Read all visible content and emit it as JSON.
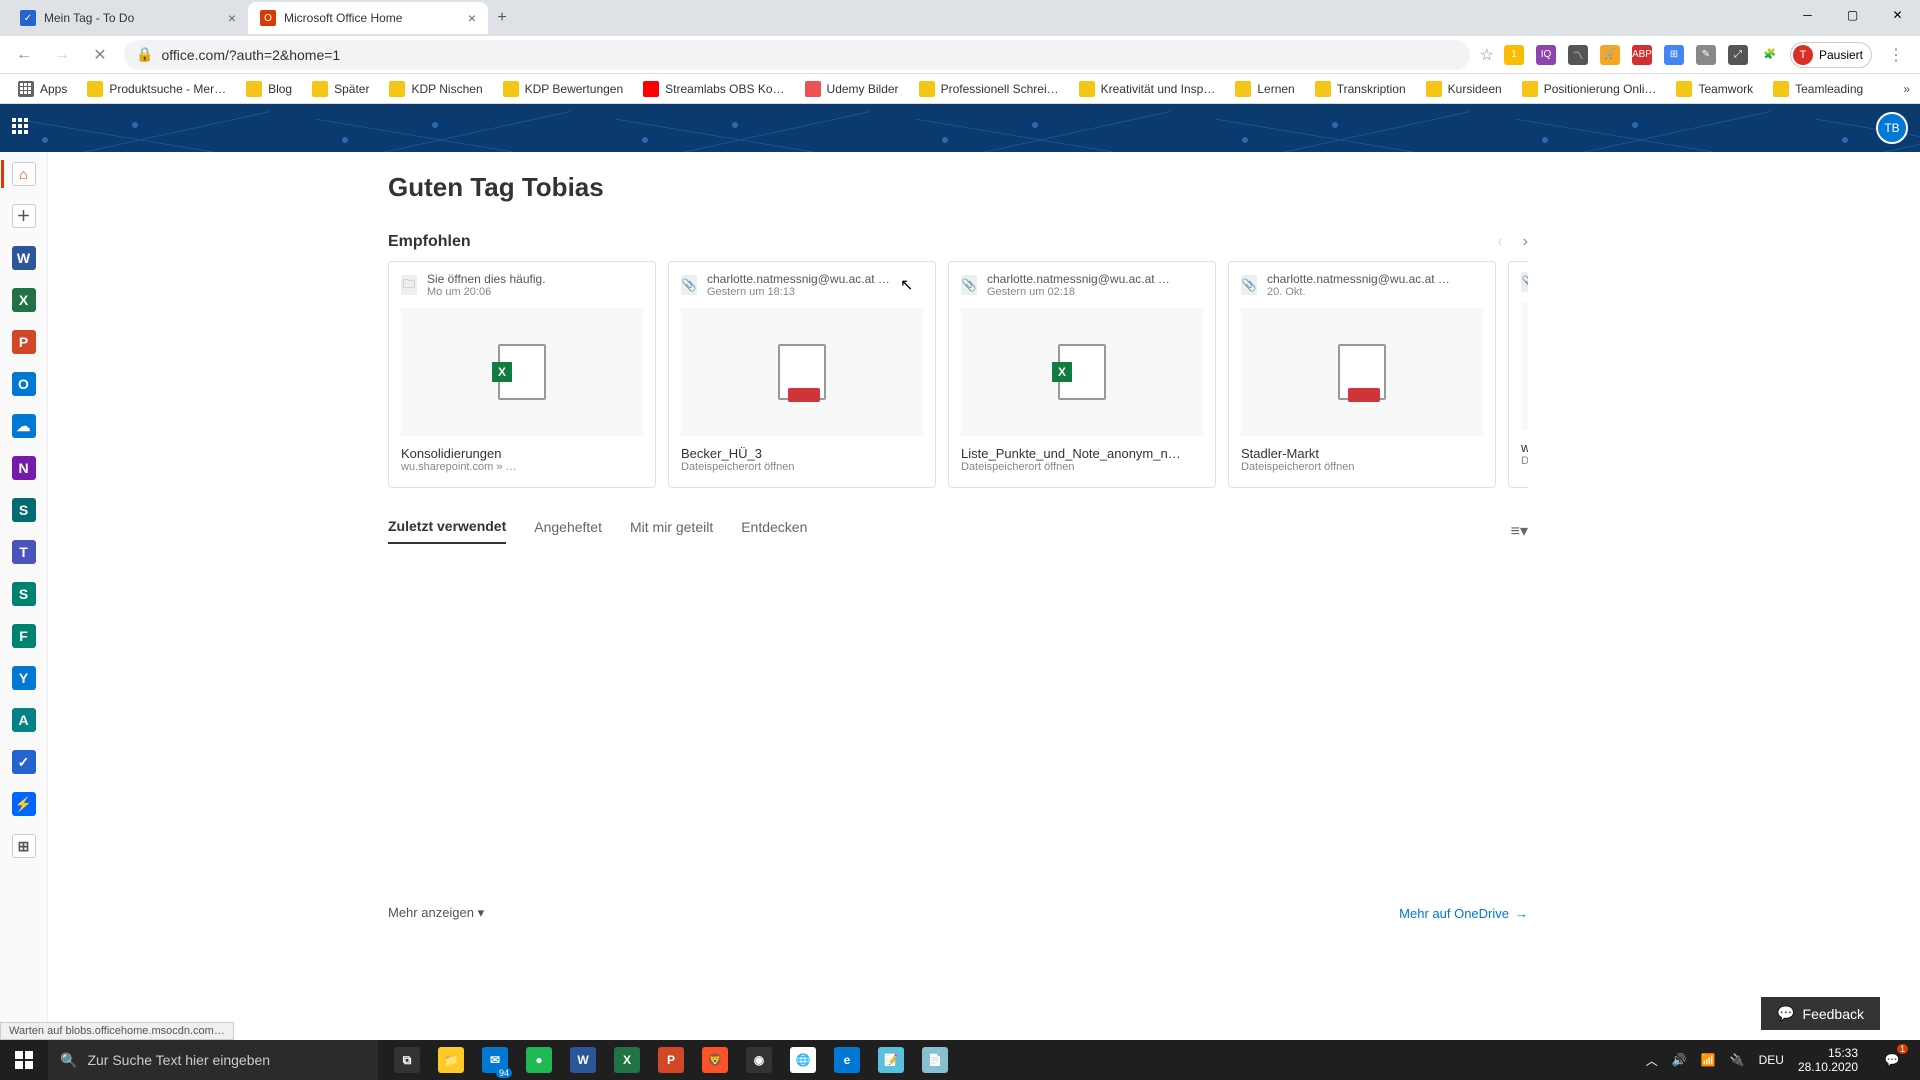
{
  "browser": {
    "tabs": [
      {
        "title": "Mein Tag - To Do",
        "active": false,
        "favicon_bg": "#2564cf"
      },
      {
        "title": "Microsoft Office Home",
        "active": true,
        "favicon_bg": "#d83b01"
      }
    ],
    "url": "office.com/?auth=2&home=1",
    "profile_label": "Pausiert",
    "profile_initial": "T",
    "bookmarks": [
      {
        "label": "Apps",
        "icon": "#5f6368"
      },
      {
        "label": "Produktsuche - Mer…",
        "icon": "#f5c518"
      },
      {
        "label": "Blog",
        "icon": "#f5c518"
      },
      {
        "label": "Später",
        "icon": "#f5c518"
      },
      {
        "label": "KDP Nischen",
        "icon": "#f5c518"
      },
      {
        "label": "KDP Bewertungen",
        "icon": "#f5c518"
      },
      {
        "label": "Streamlabs OBS Ko…",
        "icon": "#ff0000"
      },
      {
        "label": "Udemy Bilder",
        "icon": "#ec5252"
      },
      {
        "label": "Professionell Schrei…",
        "icon": "#f5c518"
      },
      {
        "label": "Kreativität und Insp…",
        "icon": "#f5c518"
      },
      {
        "label": "Lernen",
        "icon": "#f5c518"
      },
      {
        "label": "Transkription",
        "icon": "#f5c518"
      },
      {
        "label": "Kursideen",
        "icon": "#f5c518"
      },
      {
        "label": "Positionierung Onli…",
        "icon": "#f5c518"
      },
      {
        "label": "Teamwork",
        "icon": "#f5c518"
      },
      {
        "label": "Teamleading",
        "icon": "#f5c518"
      }
    ],
    "status_text": "Warten auf blobs.officehome.msocdn.com…"
  },
  "header": {
    "avatar_initials": "TB"
  },
  "left_rail": [
    {
      "name": "home",
      "bg": "#ffffff",
      "glyph": "⌂",
      "fg": "#d83b01"
    },
    {
      "name": "create",
      "bg": "#ffffff",
      "glyph": "＋",
      "fg": "#555"
    },
    {
      "name": "word",
      "bg": "#2b579a",
      "glyph": "W"
    },
    {
      "name": "excel",
      "bg": "#217346",
      "glyph": "X"
    },
    {
      "name": "powerpoint",
      "bg": "#d24726",
      "glyph": "P"
    },
    {
      "name": "outlook",
      "bg": "#0078d4",
      "glyph": "O"
    },
    {
      "name": "onedrive",
      "bg": "#0078d4",
      "glyph": "☁"
    },
    {
      "name": "onenote",
      "bg": "#7719aa",
      "glyph": "N"
    },
    {
      "name": "sharepoint",
      "bg": "#036c70",
      "glyph": "S"
    },
    {
      "name": "teams",
      "bg": "#4b53bc",
      "glyph": "T"
    },
    {
      "name": "sway",
      "bg": "#008272",
      "glyph": "S"
    },
    {
      "name": "forms",
      "bg": "#008272",
      "glyph": "F"
    },
    {
      "name": "yammer",
      "bg": "#0078d4",
      "glyph": "Y"
    },
    {
      "name": "admin",
      "bg": "#038387",
      "glyph": "A"
    },
    {
      "name": "todo",
      "bg": "#2564cf",
      "glyph": "✓"
    },
    {
      "name": "power-automate",
      "bg": "#0066ff",
      "glyph": "⚡"
    },
    {
      "name": "all-apps",
      "bg": "#ffffff",
      "glyph": "⊞",
      "fg": "#555"
    }
  ],
  "page": {
    "greeting": "Guten Tag Tobias",
    "recommended_title": "Empfohlen",
    "cards": [
      {
        "header_title": "Sie öffnen dies häufig.",
        "header_time": "Mo um 20:06",
        "icon": "folder",
        "type": "excel",
        "name": "Konsolidierungen",
        "location": "wu.sharepoint.com » …"
      },
      {
        "header_title": "charlotte.natmessnig@wu.ac.at …",
        "header_time": "Gestern um 18:13",
        "icon": "attach",
        "type": "generic",
        "name": "Becker_HÜ_3",
        "location": "Dateispeicherort öffnen"
      },
      {
        "header_title": "charlotte.natmessnig@wu.ac.at …",
        "header_time": "Gestern um 02:18",
        "icon": "attach",
        "type": "excel",
        "name": "Liste_Punkte_und_Note_anonym_n…",
        "location": "Dateispeicherort öffnen"
      },
      {
        "header_title": "charlotte.natmessnig@wu.ac.at …",
        "header_time": "20. Okt.",
        "icon": "attach",
        "type": "generic",
        "name": "Stadler-Markt",
        "location": "Dateispeicherort öffnen"
      },
      {
        "header_title": "",
        "header_time": "",
        "icon": "attach",
        "type": "generic",
        "name": "ws.",
        "location": "Dat"
      }
    ],
    "tabs": [
      {
        "label": "Zuletzt verwendet",
        "active": true
      },
      {
        "label": "Angeheftet",
        "active": false
      },
      {
        "label": "Mit mir geteilt",
        "active": false
      },
      {
        "label": "Entdecken",
        "active": false
      }
    ],
    "show_more": "Mehr anzeigen",
    "more_onedrive": "Mehr auf OneDrive",
    "feedback": "Feedback"
  },
  "taskbar": {
    "search_placeholder": "Zur Suche Text hier eingeben",
    "apps": [
      {
        "name": "task-view",
        "bg": "#333",
        "glyph": "⧉"
      },
      {
        "name": "explorer",
        "bg": "#ffca28",
        "glyph": "📁"
      },
      {
        "name": "mail",
        "bg": "#0078d4",
        "glyph": "✉",
        "badge": "94"
      },
      {
        "name": "spotify",
        "bg": "#1db954",
        "glyph": "●"
      },
      {
        "name": "word",
        "bg": "#2b579a",
        "glyph": "W"
      },
      {
        "name": "excel",
        "bg": "#217346",
        "glyph": "X"
      },
      {
        "name": "powerpoint",
        "bg": "#d24726",
        "glyph": "P"
      },
      {
        "name": "brave",
        "bg": "#fb542b",
        "glyph": "🦁"
      },
      {
        "name": "obs",
        "bg": "#333",
        "glyph": "◉"
      },
      {
        "name": "chrome",
        "bg": "#fff",
        "glyph": "🌐"
      },
      {
        "name": "edge",
        "bg": "#0078d4",
        "glyph": "e"
      },
      {
        "name": "notepad",
        "bg": "#5bc0de",
        "glyph": "📝"
      },
      {
        "name": "wordpad",
        "bg": "#88c0d0",
        "glyph": "📄"
      }
    ],
    "lang": "DEU",
    "time": "15:33",
    "date": "28.10.2020",
    "notif_count": "1"
  }
}
